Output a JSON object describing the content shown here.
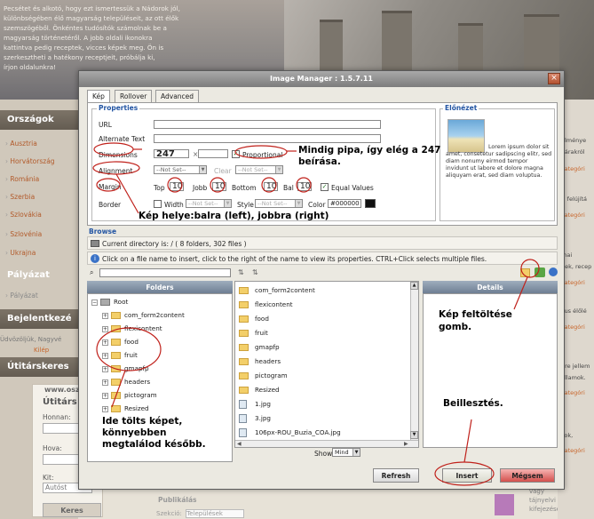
{
  "page": {
    "intro_lines": [
      "Pecsétet és alkotó, hogy ezt ismertessük a Nádorok jól,",
      "különbségében élő magyarság településeit, az ott élők",
      "szemszögéből. Önkéntes tudósítók számolnak be a",
      "magyarság történetéről. A jobb oldali ikonokra",
      "kattintva pedig receptek, vicces képek meg. Ön is",
      "szerkesztheti a hatékony receptjeit, próbálja ki,",
      "írjon oldalunkra!"
    ],
    "sidebar": {
      "countries_title": "Országok",
      "countries": [
        "Ausztria",
        "Horvátország",
        "Románia",
        "Szerbia",
        "Szlovákia",
        "Szlovénia",
        "Ukrajna"
      ],
      "tender_title": "Pályázat",
      "tender_items": [
        "Pályázat"
      ],
      "login_title": "Bejelentkezé",
      "login_text": "Üdvözöljük, Nagyvé",
      "login_link": "Kilép",
      "travel_title": "Útitárskeres",
      "site_url": "www.osz",
      "travel_head": "Útitárs k",
      "from_label": "Honnan:",
      "to_label": "Hova:",
      "when_label": "Kit:",
      "car_value": "Autóst",
      "search_button": "Keres"
    },
    "right_column": [
      {
        "text": "élménye",
        "link": false
      },
      {
        "text": "várakról",
        "link": false
      },
      {
        "text": "kategóri",
        "link": true
      },
      {
        "text": "t, felújítá",
        "link": false
      },
      {
        "text": "kategóri",
        "link": true
      },
      {
        "text": "mai",
        "link": false
      },
      {
        "text": "gek, recep",
        "link": false
      },
      {
        "text": "kategóri",
        "link": true
      },
      {
        "text": "kus élőlé",
        "link": false
      },
      {
        "text": "kategóri",
        "link": true
      },
      {
        "text": "gre jellem",
        "link": false
      },
      {
        "text": "államok.",
        "link": false
      },
      {
        "text": "kategóri",
        "link": true
      },
      {
        "text": "sok,",
        "link": false
      },
      {
        "text": "kategóri",
        "link": true
      }
    ],
    "footer": {
      "publish_title": "Publikálás",
      "settlement_label": "Szekció:",
      "settlement_value": "Települések",
      "right_text": [
        "vagy",
        "tájnyelvi szavak,",
        "kifejezések."
      ]
    }
  },
  "dialog": {
    "title": "Image Manager : 1.5.7.11",
    "close": "×",
    "tabs": [
      "Kép",
      "Rollover",
      "Advanced"
    ],
    "properties_legend": "Properties",
    "preview_legend": "Előnézet",
    "preview_text": "Lorem ipsum dolor sit amet, consetetur sadipscing elitr, sed diam nonumy eirmod tempor invidunt ut labore et dolore magna aliquyam erat, sed diam voluptua.",
    "fields": {
      "url_label": "URL",
      "alt_label": "Alternate Text",
      "dimensions_label": "Dimensions",
      "width_value": "247",
      "height_value": "",
      "proportional_label": "Proportional",
      "proportional_checked": true,
      "alignment_label": "Alignment",
      "alignment_value": "--Not Set--",
      "clear_label": "Clear",
      "clear_value": "--Not Set--",
      "margin_label": "Margin",
      "top_label": "Top",
      "top_value": "10",
      "right_label": "Jobb",
      "right_value": "10",
      "bottom_label": "Bottom",
      "bottom_value": "10",
      "left_label": "Bal",
      "left_value": "10",
      "equal_values_label": "Equal Values",
      "equal_checked": true,
      "border_label": "Border",
      "border_width_label": "Width",
      "border_width_value": "--Not Set--",
      "border_style_label": "Style",
      "border_style_value": "--Not Set--",
      "border_color_label": "Color",
      "border_color_value": "#000000"
    },
    "browse": {
      "legend": "Browse",
      "current_dir": "Current directory is: / ( 8 folders, 302 files )",
      "info": "Click on a file name to insert, click to the right of the name to view its properties. CTRL+Click selects multiple files.",
      "folders_header": "Folders",
      "details_header": "Details",
      "tree": [
        {
          "name": "Root",
          "level": 0,
          "expander": "−"
        },
        {
          "name": "com_form2content",
          "level": 1,
          "expander": "+"
        },
        {
          "name": "flexicontent",
          "level": 1,
          "expander": "+"
        },
        {
          "name": "food",
          "level": 1,
          "expander": "+"
        },
        {
          "name": "fruit",
          "level": 1,
          "expander": "+"
        },
        {
          "name": "gmapfp",
          "level": 1,
          "expander": "+"
        },
        {
          "name": "headers",
          "level": 1,
          "expander": "+"
        },
        {
          "name": "pictogram",
          "level": 1,
          "expander": "+"
        },
        {
          "name": "Resized",
          "level": 1,
          "expander": "+"
        }
      ],
      "files": [
        {
          "name": "com_form2content",
          "kind": "folder"
        },
        {
          "name": "flexicontent",
          "kind": "folder"
        },
        {
          "name": "food",
          "kind": "folder"
        },
        {
          "name": "fruit",
          "kind": "folder"
        },
        {
          "name": "gmapfp",
          "kind": "folder"
        },
        {
          "name": "headers",
          "kind": "folder"
        },
        {
          "name": "pictogram",
          "kind": "folder"
        },
        {
          "name": "Resized",
          "kind": "folder"
        },
        {
          "name": "1.jpg",
          "kind": "image"
        },
        {
          "name": "3.jpg",
          "kind": "image"
        },
        {
          "name": "106px-ROU_Buzia_COA.jpg",
          "kind": "image"
        }
      ],
      "show_label": "Show",
      "show_value": "Mind"
    },
    "buttons": {
      "refresh": "Refresh",
      "insert": "Insert",
      "cancel": "Mégsem"
    }
  },
  "annotations": {
    "proportional_note": "Mindig pipa, így elég a 247 beírása.",
    "alignment_note": "Kép helye:balra (left), jobbra (right)",
    "upload_note": "Kép feltöltése gomb.",
    "insert_note": "Beillesztés.",
    "folder_note": "Ide tölts képet, könnyebben megtalálod később."
  },
  "colors": {
    "accent_blue": "#2355a3",
    "annotation_red": "#c0211b",
    "insert_green": "#3f8f2f",
    "cancel_red": "#d3504d"
  }
}
